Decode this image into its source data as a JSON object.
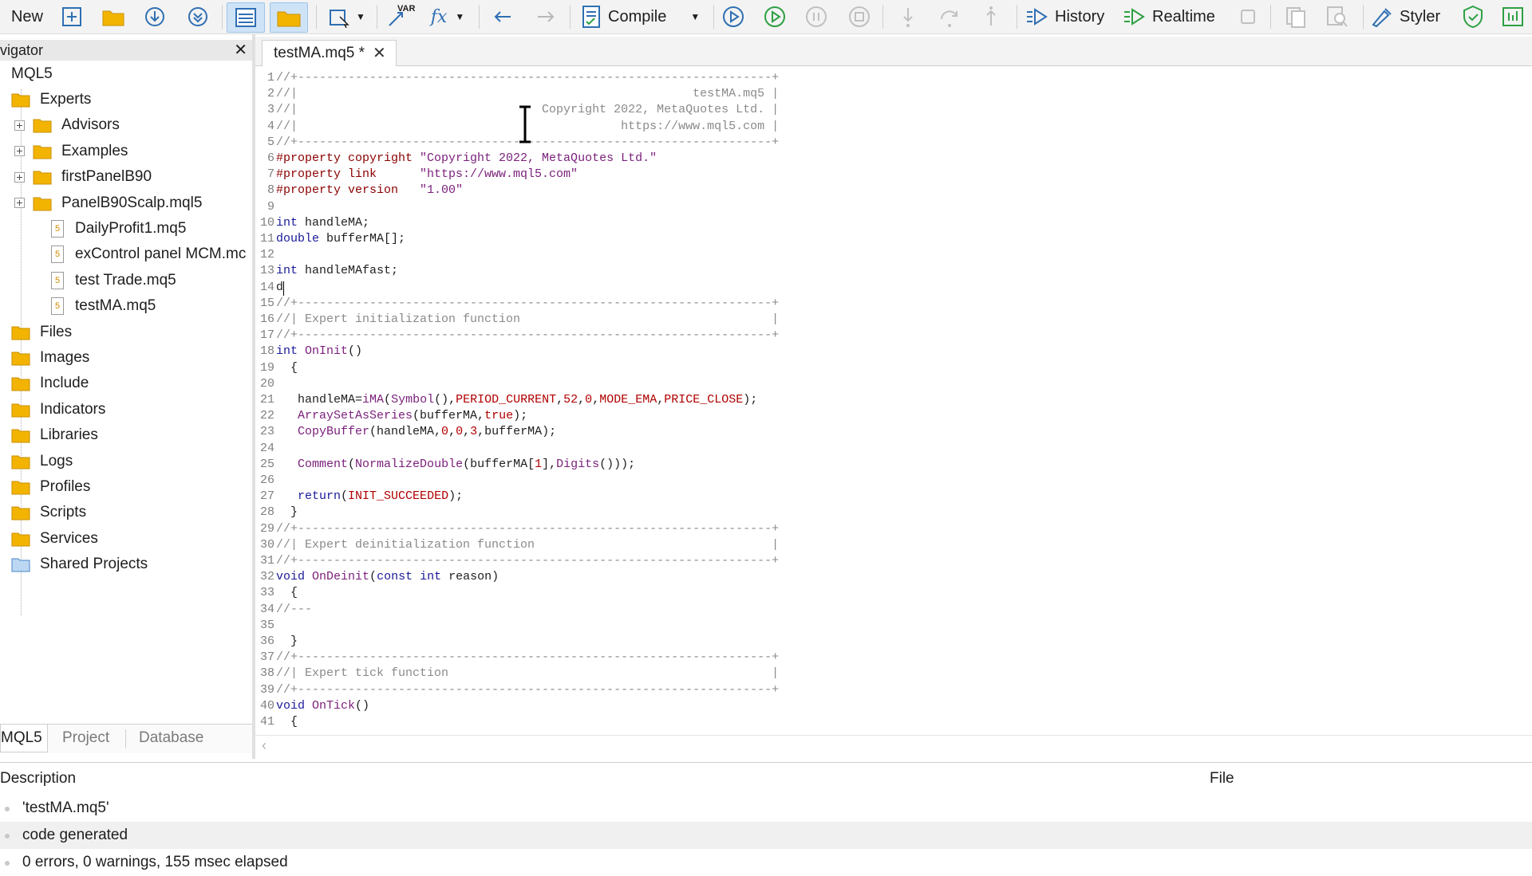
{
  "toolbar": {
    "new_label": "New",
    "compile_label": "Compile",
    "history_label": "History",
    "realtime_label": "Realtime",
    "styler_label": "Styler",
    "var_icon_text": "VAR",
    "fx_icon_text": "fx",
    "colors": {
      "blue": "#2f6fb3",
      "green": "#2ea043",
      "folder": "#f2b400",
      "gray": "#a8a8a8"
    }
  },
  "navigator": {
    "title": "vigator",
    "close_glyph": "✕",
    "root": "MQL5",
    "items": [
      {
        "label": "Experts",
        "kind": "folder"
      },
      {
        "label": "Advisors",
        "kind": "folder"
      },
      {
        "label": "Examples",
        "kind": "folder"
      },
      {
        "label": "firstPanelB90",
        "kind": "folder"
      },
      {
        "label": "PanelB90Scalp.mql5",
        "kind": "folder"
      },
      {
        "label": "DailyProfit1.mq5",
        "kind": "file"
      },
      {
        "label": "exControl panel MCM.mc",
        "kind": "file"
      },
      {
        "label": "test Trade.mq5",
        "kind": "file"
      },
      {
        "label": "testMA.mq5",
        "kind": "file"
      },
      {
        "label": "Files",
        "kind": "folder"
      },
      {
        "label": "Images",
        "kind": "folder"
      },
      {
        "label": "Include",
        "kind": "folder"
      },
      {
        "label": "Indicators",
        "kind": "folder"
      },
      {
        "label": "Libraries",
        "kind": "folder"
      },
      {
        "label": "Logs",
        "kind": "folder"
      },
      {
        "label": "Profiles",
        "kind": "folder"
      },
      {
        "label": "Scripts",
        "kind": "folder"
      },
      {
        "label": "Services",
        "kind": "folder"
      },
      {
        "label": "Shared Projects",
        "kind": "shared-folder"
      }
    ],
    "file_icon_text": "5",
    "tabs": [
      "MQL5",
      "Project",
      "Database"
    ]
  },
  "editor": {
    "tab_label": "testMA.mq5 *",
    "tab_close": "✕",
    "lines": [
      [
        [
          "c-com",
          "//+------------------------------------------------------------------+"
        ]
      ],
      [
        [
          "c-com",
          "//|                                                       testMA.mq5 |"
        ]
      ],
      [
        [
          "c-com",
          "//|                                  Copyright 2022, MetaQuotes Ltd. |"
        ]
      ],
      [
        [
          "c-com",
          "//|                                             https://www.mql5.com |"
        ]
      ],
      [
        [
          "c-com",
          "//+------------------------------------------------------------------+"
        ]
      ],
      [
        [
          "c-mac",
          "#property copyright "
        ],
        [
          "c-str",
          "\"Copyright 2022, MetaQuotes Ltd.\""
        ]
      ],
      [
        [
          "c-mac",
          "#property link      "
        ],
        [
          "c-str",
          "\"https://www.mql5.com\""
        ]
      ],
      [
        [
          "c-mac",
          "#property version   "
        ],
        [
          "c-str",
          "\"1.00\""
        ]
      ],
      [],
      [
        [
          "c-kw",
          "int"
        ],
        [
          "c-id",
          " handleMA;"
        ]
      ],
      [
        [
          "c-kw",
          "double"
        ],
        [
          "c-id",
          " bufferMA[];"
        ]
      ],
      [],
      [
        [
          "c-kw",
          "int"
        ],
        [
          "c-id",
          " handleMAfast;"
        ]
      ],
      [
        [
          "c-id",
          "d"
        ]
      ],
      [
        [
          "c-com",
          "//+------------------------------------------------------------------+"
        ]
      ],
      [
        [
          "c-com",
          "//| Expert initialization function                                   |"
        ]
      ],
      [
        [
          "c-com",
          "//+------------------------------------------------------------------+"
        ]
      ],
      [
        [
          "c-kw",
          "int"
        ],
        [
          "c-id",
          " "
        ],
        [
          "c-fn",
          "OnInit"
        ],
        [
          "c-id",
          "()"
        ]
      ],
      [
        [
          "c-id",
          "  {"
        ]
      ],
      [],
      [
        [
          "c-id",
          "   handleMA="
        ],
        [
          "c-fn",
          "iMA"
        ],
        [
          "c-id",
          "("
        ],
        [
          "c-fn",
          "Symbol"
        ],
        [
          "c-id",
          "(),"
        ],
        [
          "c-const",
          "PERIOD_CURRENT"
        ],
        [
          "c-id",
          ","
        ],
        [
          "c-num",
          "52"
        ],
        [
          "c-id",
          ","
        ],
        [
          "c-num",
          "0"
        ],
        [
          "c-id",
          ","
        ],
        [
          "c-const",
          "MODE_EMA"
        ],
        [
          "c-id",
          ","
        ],
        [
          "c-const",
          "PRICE_CLOSE"
        ],
        [
          "c-id",
          ");"
        ]
      ],
      [
        [
          "c-id",
          "   "
        ],
        [
          "c-fn",
          "ArraySetAsSeries"
        ],
        [
          "c-id",
          "(bufferMA,"
        ],
        [
          "c-const",
          "true"
        ],
        [
          "c-id",
          ");"
        ]
      ],
      [
        [
          "c-id",
          "   "
        ],
        [
          "c-fn",
          "CopyBuffer"
        ],
        [
          "c-id",
          "(handleMA,"
        ],
        [
          "c-num",
          "0"
        ],
        [
          "c-id",
          ","
        ],
        [
          "c-num",
          "0"
        ],
        [
          "c-id",
          ","
        ],
        [
          "c-num",
          "3"
        ],
        [
          "c-id",
          ",bufferMA);"
        ]
      ],
      [],
      [
        [
          "c-id",
          "   "
        ],
        [
          "c-fn",
          "Comment"
        ],
        [
          "c-id",
          "("
        ],
        [
          "c-fn",
          "NormalizeDouble"
        ],
        [
          "c-id",
          "(bufferMA["
        ],
        [
          "c-num",
          "1"
        ],
        [
          "c-id",
          "],"
        ],
        [
          "c-fn",
          "Digits"
        ],
        [
          "c-id",
          "()));"
        ]
      ],
      [],
      [
        [
          "c-id",
          "   "
        ],
        [
          "c-kw",
          "return"
        ],
        [
          "c-id",
          "("
        ],
        [
          "c-const",
          "INIT_SUCCEEDED"
        ],
        [
          "c-id",
          ");"
        ]
      ],
      [
        [
          "c-id",
          "  }"
        ]
      ],
      [
        [
          "c-com",
          "//+------------------------------------------------------------------+"
        ]
      ],
      [
        [
          "c-com",
          "//| Expert deinitialization function                                 |"
        ]
      ],
      [
        [
          "c-com",
          "//+------------------------------------------------------------------+"
        ]
      ],
      [
        [
          "c-kw",
          "void"
        ],
        [
          "c-id",
          " "
        ],
        [
          "c-fn",
          "OnDeinit"
        ],
        [
          "c-id",
          "("
        ],
        [
          "c-kw",
          "const int"
        ],
        [
          "c-id",
          " reason)"
        ]
      ],
      [
        [
          "c-id",
          "  {"
        ]
      ],
      [
        [
          "c-com",
          "//---"
        ]
      ],
      [],
      [
        [
          "c-id",
          "  }"
        ]
      ],
      [
        [
          "c-com",
          "//+------------------------------------------------------------------+"
        ]
      ],
      [
        [
          "c-com",
          "//| Expert tick function                                             |"
        ]
      ],
      [
        [
          "c-com",
          "//+------------------------------------------------------------------+"
        ]
      ],
      [
        [
          "c-kw",
          "void"
        ],
        [
          "c-id",
          " "
        ],
        [
          "c-fn",
          "OnTick"
        ],
        [
          "c-id",
          "()"
        ]
      ],
      [
        [
          "c-id",
          "  {"
        ]
      ]
    ]
  },
  "bottom_panel": {
    "col_description": "Description",
    "col_file": "File",
    "rows": [
      "'testMA.mq5'",
      "code generated",
      "0 errors, 0 warnings, 155 msec elapsed"
    ]
  }
}
